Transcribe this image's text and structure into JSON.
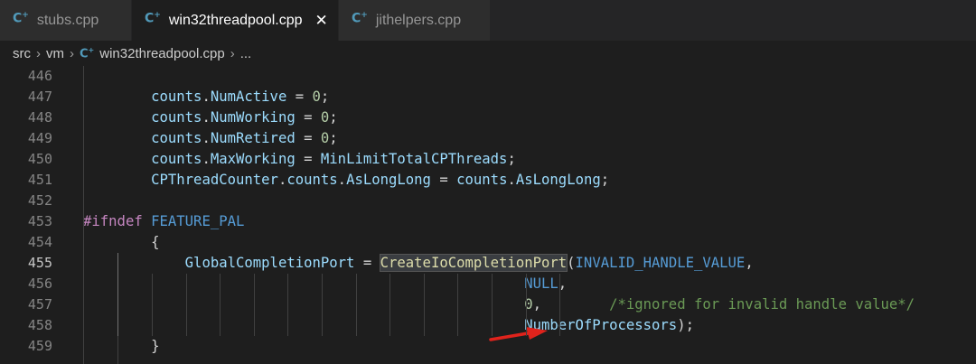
{
  "tabs": [
    {
      "label": "stubs.cpp",
      "active": false
    },
    {
      "label": "win32threadpool.cpp",
      "active": true
    },
    {
      "label": "jithelpers.cpp",
      "active": false
    }
  ],
  "tab_close_glyph": "✕",
  "file_icon_glyph": "C",
  "file_icon_sup": "+",
  "breadcrumb": {
    "parts": [
      "src",
      "vm",
      "win32threadpool.cpp",
      "..."
    ],
    "separator": "›"
  },
  "current_line": "455",
  "lines": [
    {
      "num": "446",
      "tokens": []
    },
    {
      "num": "447",
      "tokens": [
        {
          "t": "        "
        },
        {
          "t": "counts",
          "c": "var"
        },
        {
          "t": "."
        },
        {
          "t": "NumActive",
          "c": "var"
        },
        {
          "t": " = "
        },
        {
          "t": "0",
          "c": "num"
        },
        {
          "t": ";"
        }
      ]
    },
    {
      "num": "448",
      "tokens": [
        {
          "t": "        "
        },
        {
          "t": "counts",
          "c": "var"
        },
        {
          "t": "."
        },
        {
          "t": "NumWorking",
          "c": "var"
        },
        {
          "t": " = "
        },
        {
          "t": "0",
          "c": "num"
        },
        {
          "t": ";"
        }
      ]
    },
    {
      "num": "449",
      "tokens": [
        {
          "t": "        "
        },
        {
          "t": "counts",
          "c": "var"
        },
        {
          "t": "."
        },
        {
          "t": "NumRetired",
          "c": "var"
        },
        {
          "t": " = "
        },
        {
          "t": "0",
          "c": "num"
        },
        {
          "t": ";"
        }
      ]
    },
    {
      "num": "450",
      "tokens": [
        {
          "t": "        "
        },
        {
          "t": "counts",
          "c": "var"
        },
        {
          "t": "."
        },
        {
          "t": "MaxWorking",
          "c": "var"
        },
        {
          "t": " = "
        },
        {
          "t": "MinLimitTotalCPThreads",
          "c": "var"
        },
        {
          "t": ";"
        }
      ]
    },
    {
      "num": "451",
      "tokens": [
        {
          "t": "        "
        },
        {
          "t": "CPThreadCounter",
          "c": "var"
        },
        {
          "t": "."
        },
        {
          "t": "counts",
          "c": "var"
        },
        {
          "t": "."
        },
        {
          "t": "AsLongLong",
          "c": "var"
        },
        {
          "t": " = "
        },
        {
          "t": "counts",
          "c": "var"
        },
        {
          "t": "."
        },
        {
          "t": "AsLongLong",
          "c": "var"
        },
        {
          "t": ";"
        }
      ]
    },
    {
      "num": "452",
      "tokens": []
    },
    {
      "num": "453",
      "tokens": [
        {
          "t": "#ifndef",
          "c": "kw"
        },
        {
          "t": " "
        },
        {
          "t": "FEATURE_PAL",
          "c": "mac"
        }
      ]
    },
    {
      "num": "454",
      "tokens": [
        {
          "t": "        {"
        }
      ]
    },
    {
      "num": "455",
      "tokens": [
        {
          "t": "            "
        },
        {
          "t": "GlobalCompletionPort",
          "c": "var"
        },
        {
          "t": " = "
        },
        {
          "t": "CreateIoCompletionPort",
          "c": "fn hl"
        },
        {
          "t": "("
        },
        {
          "t": "INVALID_HANDLE_VALUE",
          "c": "mac"
        },
        {
          "t": ","
        }
      ]
    },
    {
      "num": "456",
      "tokens": [
        {
          "t": "                                                    "
        },
        {
          "t": "NULL",
          "c": "mac"
        },
        {
          "t": ","
        }
      ]
    },
    {
      "num": "457",
      "tokens": [
        {
          "t": "                                                    "
        },
        {
          "t": "0",
          "c": "num"
        },
        {
          "t": ",        "
        },
        {
          "t": "/*ignored for invalid handle value*/",
          "c": "cmt"
        }
      ]
    },
    {
      "num": "458",
      "tokens": [
        {
          "t": "                                                    "
        },
        {
          "t": "NumberOfProcessors",
          "c": "var"
        },
        {
          "t": ");"
        }
      ]
    },
    {
      "num": "459",
      "tokens": [
        {
          "t": "        }"
        }
      ]
    }
  ],
  "colors": {
    "arrow": "#e0231c",
    "accent": "#519aba"
  }
}
